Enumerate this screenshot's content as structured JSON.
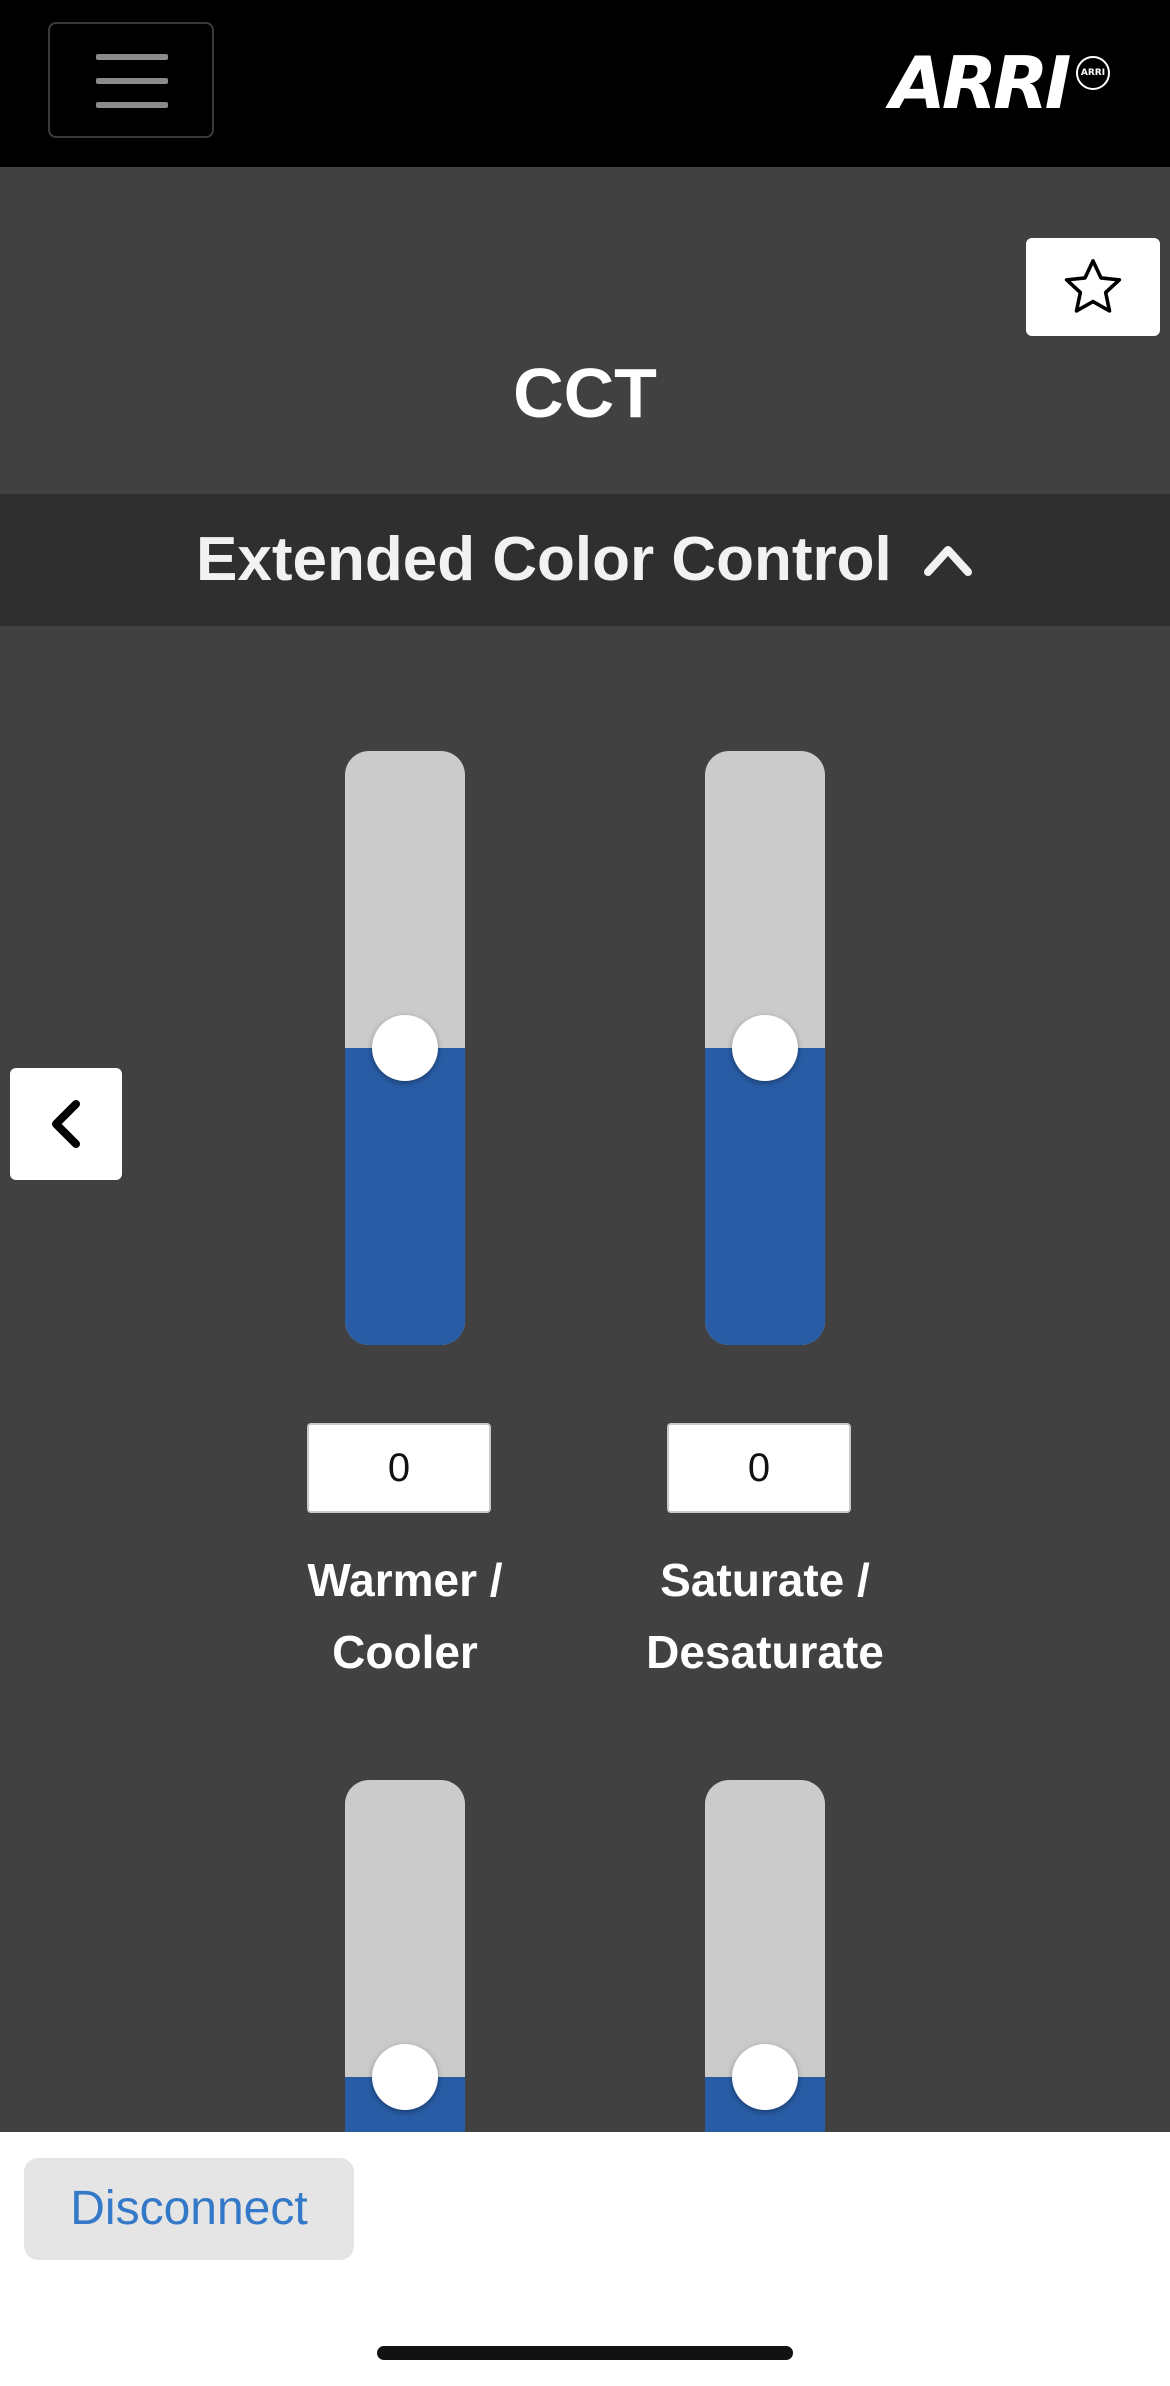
{
  "header": {
    "menu_icon": "hamburger-menu-icon",
    "logo_text": "ARRI",
    "logo_mark_text": "ARRI"
  },
  "favorite": {
    "icon": "star-outline-icon"
  },
  "page": {
    "title": "CCT"
  },
  "extended_color_control": {
    "label": "Extended Color Control",
    "icon": "chevron-up-icon",
    "expanded": true
  },
  "sliders": [
    {
      "label_line1": "Warmer /",
      "label_line2": "Cooler",
      "value": "0",
      "fill_fraction": 0.5
    },
    {
      "label_line1": "Saturate /",
      "label_line2": "Desaturate",
      "value": "0",
      "fill_fraction": 0.5
    },
    {
      "fill_fraction": 0.5
    },
    {
      "fill_fraction": 0.5
    }
  ],
  "navigation": {
    "back_icon": "chevron-left-icon"
  },
  "footer": {
    "disconnect_label": "Disconnect"
  },
  "colors": {
    "background": "#414141",
    "topbar": "#000000",
    "header_band": "#2f2f2f",
    "slider_track": "#cbcbcb",
    "slider_fill": "#285ca5",
    "disconnect_text": "#3479c8"
  }
}
